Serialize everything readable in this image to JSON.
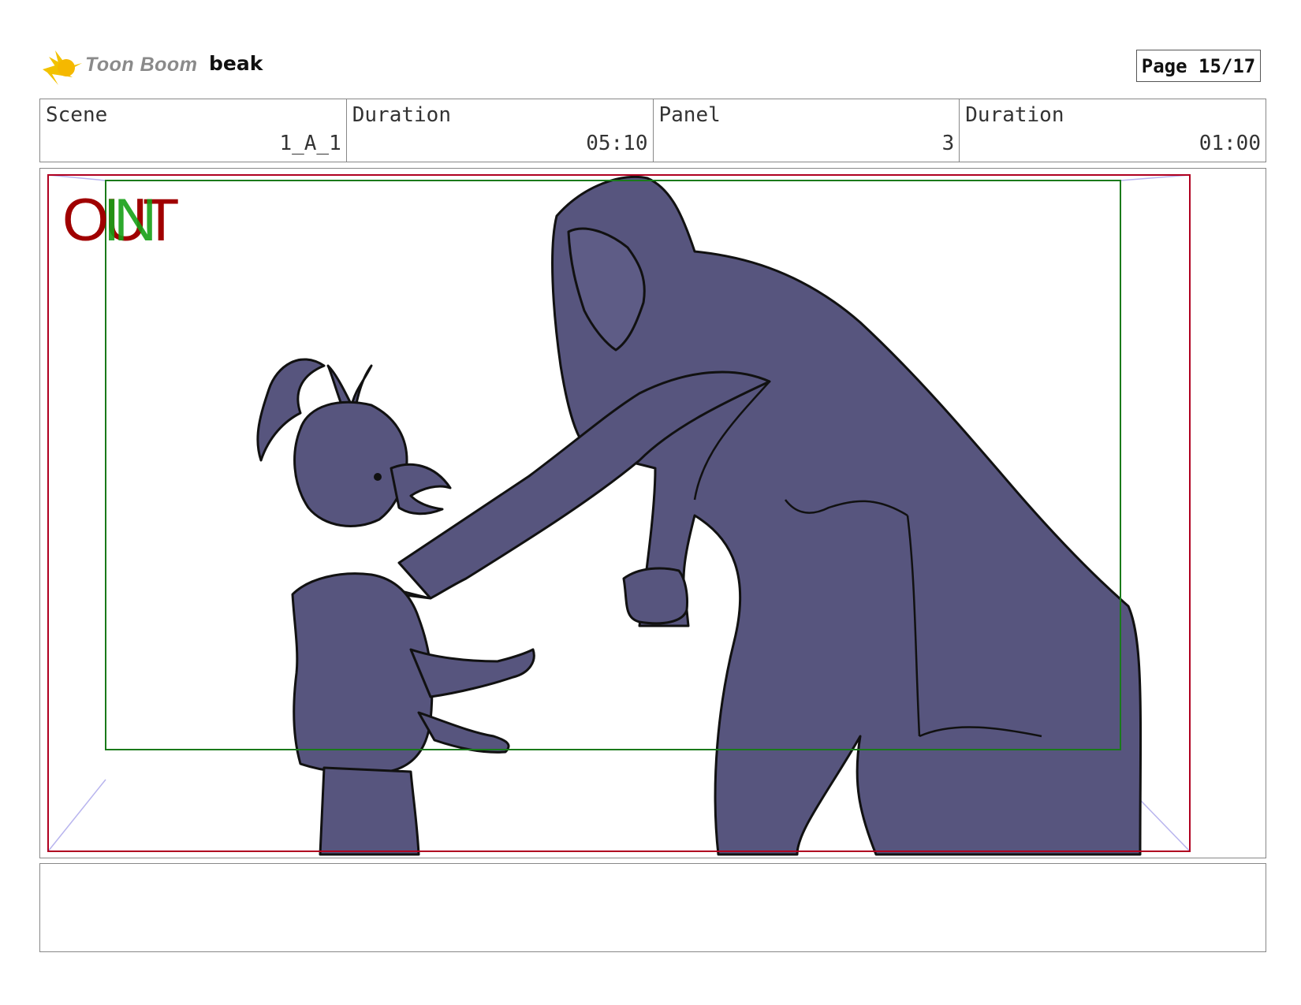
{
  "header": {
    "logo_icon": "toon-boom-star-icon",
    "brand": "Toon Boom",
    "project": "beak",
    "page": "Page 15/17"
  },
  "info": {
    "scene_label": "Scene",
    "scene_value": "1_A_1",
    "scene_duration_label": "Duration",
    "scene_duration_value": "05:10",
    "panel_label": "Panel",
    "panel_value": "3",
    "panel_duration_label": "Duration",
    "panel_duration_value": "01:00"
  },
  "panel": {
    "camera_out_label": "OUT",
    "camera_in_label": "IN",
    "fill_color": "#57557e",
    "frame_out_color": "#b00020",
    "frame_in_color": "#1a7a1a"
  },
  "notes": {
    "text": ""
  }
}
